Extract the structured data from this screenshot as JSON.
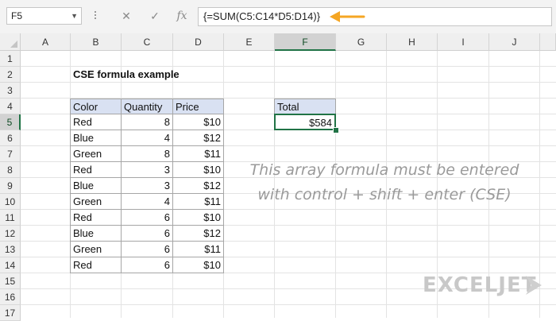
{
  "formula_bar": {
    "name_box": "F5",
    "cancel_icon": "✕",
    "enter_icon": "✓",
    "fx_icon": "fx",
    "formula": "{=SUM(C5:C14*D5:D14)}"
  },
  "columns": [
    "A",
    "B",
    "C",
    "D",
    "E",
    "F",
    "G",
    "H",
    "I",
    "J"
  ],
  "rows": [
    "1",
    "2",
    "3",
    "4",
    "5",
    "6",
    "7",
    "8",
    "9",
    "10",
    "11",
    "12",
    "13",
    "14",
    "15",
    "16",
    "17"
  ],
  "sheet": {
    "title": "CSE formula example",
    "table": {
      "headers": [
        "Color",
        "Quantity",
        "Price"
      ],
      "rows": [
        [
          "Red",
          "8",
          "$10"
        ],
        [
          "Blue",
          "4",
          "$12"
        ],
        [
          "Green",
          "8",
          "$11"
        ],
        [
          "Red",
          "3",
          "$10"
        ],
        [
          "Blue",
          "3",
          "$12"
        ],
        [
          "Green",
          "4",
          "$11"
        ],
        [
          "Red",
          "6",
          "$10"
        ],
        [
          "Blue",
          "6",
          "$12"
        ],
        [
          "Green",
          "6",
          "$11"
        ],
        [
          "Red",
          "6",
          "$10"
        ]
      ]
    },
    "total_label": "Total",
    "total_value": "$584",
    "note_line1": "This array formula must be entered",
    "note_line2": "with control + shift + enter (CSE)"
  },
  "brand": {
    "logo_text": "EXCELJET"
  },
  "colors": {
    "accent": "#217346",
    "header_fill": "#d9e1f2",
    "arrow": "#f5a623"
  }
}
